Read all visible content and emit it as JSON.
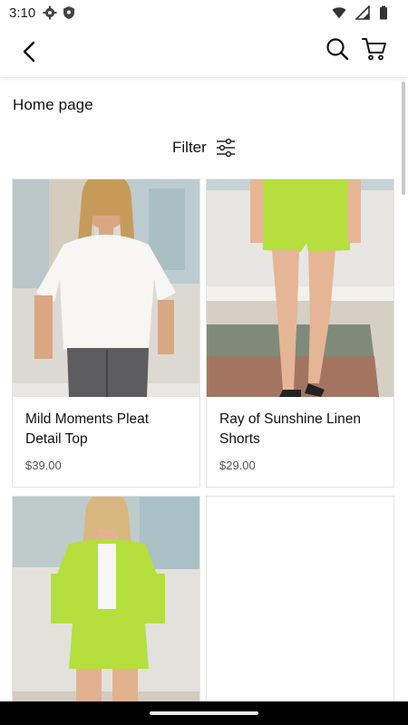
{
  "status_bar": {
    "time": "3:10"
  },
  "header": {
    "back_icon": "chevron-left-icon",
    "search_icon": "search-icon",
    "cart_icon": "cart-icon"
  },
  "page": {
    "title": "Home page",
    "filter_label": "Filter",
    "filter_icon": "sliders-icon"
  },
  "products": [
    {
      "name": "Mild Moments Pleat Detail Top",
      "price": "$39.00"
    },
    {
      "name": "Ray of Sunshine Linen Shorts",
      "price": "$29.00"
    },
    {
      "name": "",
      "price": ""
    },
    {
      "name": "",
      "price": ""
    }
  ],
  "colors": {
    "accent_lime": "#b4df3c",
    "text": "#111111",
    "border": "#e4e4e4"
  }
}
